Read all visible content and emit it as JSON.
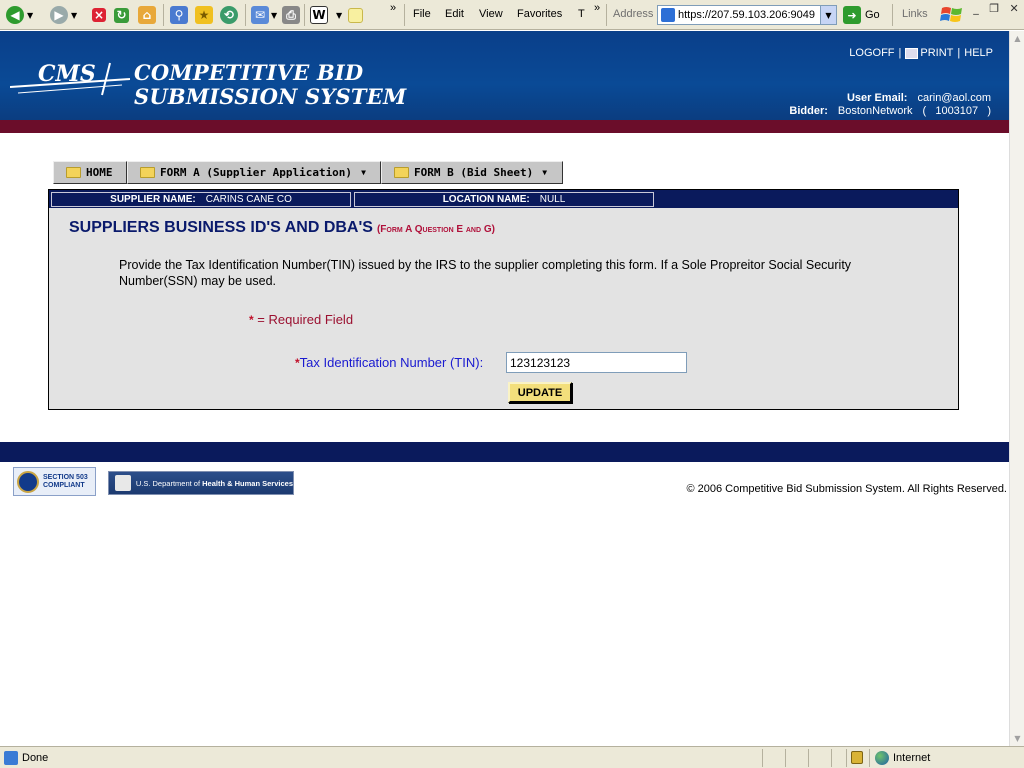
{
  "browser": {
    "menu": [
      "File",
      "Edit",
      "View",
      "Favorites",
      "T"
    ],
    "address_label": "Address",
    "url": "https://207.59.103.206:9049",
    "go_label": "Go",
    "links_label": "Links",
    "status_text": "Done",
    "zone_text": "Internet",
    "chevron": "»"
  },
  "header": {
    "logo_text": "CMS",
    "title_line1": "COMPETITIVE BID",
    "title_line2": "SUBMISSION SYSTEM",
    "logoff": "LOGOFF",
    "print": "PRINT",
    "help": "HELP",
    "sep": "|",
    "user_email_label": "User Email:",
    "user_email": "carin@aol.com",
    "bidder_label": "Bidder:",
    "bidder_name": "BostonNetwork",
    "bidder_id": "(   1003107   )"
  },
  "nav": {
    "home": "HOME",
    "form_a": "FORM A (Supplier Application)",
    "form_b": "FORM B (Bid Sheet)"
  },
  "info": {
    "supplier_label": "SUPPLIER NAME:",
    "supplier_value": "CARINS CANE CO",
    "location_label": "LOCATION NAME:",
    "location_value": "NULL"
  },
  "section": {
    "title": "SUPPLIERS BUSINESS ID'S AND DBA'S",
    "subtitle": "(Form A Question E and G)",
    "instructions": "Provide the Tax Identification Number(TIN) issued by the IRS to the supplier completing this form. If a Sole Propreitor Social Security Number(SSN) may be used.",
    "required_legend": "= Required Field",
    "tin_label": "Tax Identification Number (TIN):",
    "tin_value": "123123123",
    "update_label": "UPDATE"
  },
  "footer": {
    "badge_line1": "SECTION 503",
    "badge_line2": "COMPLIANT",
    "hhs_prefix": "U.S. Department of ",
    "hhs_bold": "Health & Human Services",
    "copyright": "© 2006 Competitive Bid Submission System. All Rights Reserved."
  },
  "colors": {
    "header_blue": "#0a4a96",
    "maroon_band": "#6b0d2a",
    "navy": "#0a1a5c",
    "required_red": "#c0102a",
    "update_yellow": "#f3df7c"
  }
}
